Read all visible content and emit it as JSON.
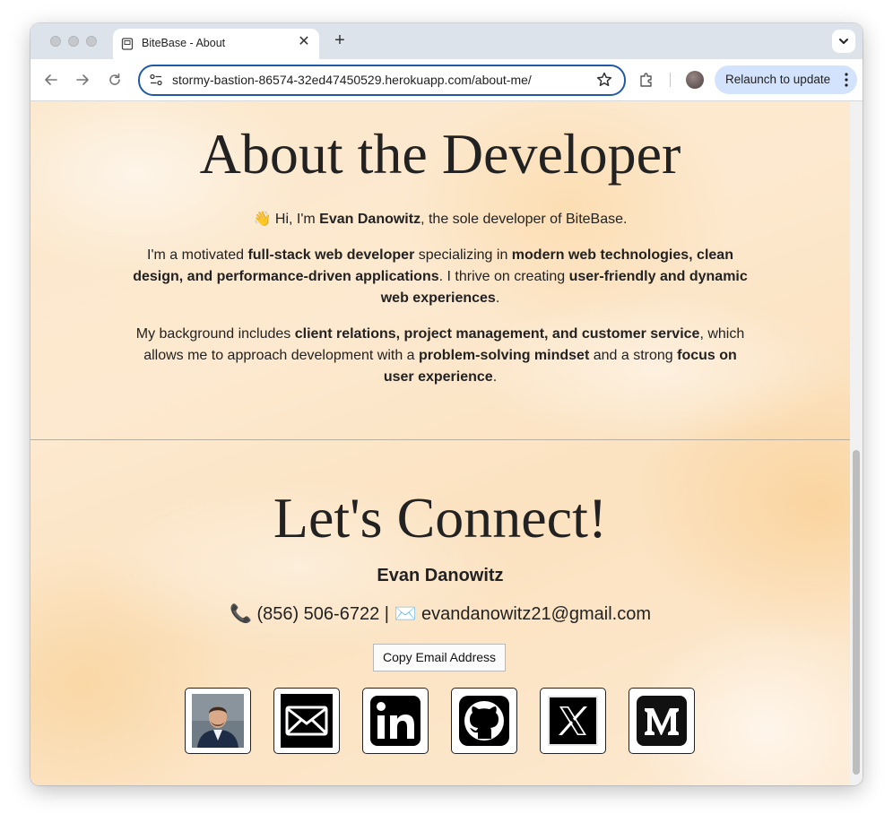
{
  "browser": {
    "tab_title": "BiteBase - About",
    "url": "stormy-bastion-86574-32ed47450529.herokuapp.com/about-me/",
    "relaunch_label": "Relaunch to update",
    "new_tab_symbol": "+",
    "close_symbol": "✕"
  },
  "about": {
    "title": "About the Developer",
    "intro": {
      "wave_icon": "👋",
      "pre": " Hi, I'm ",
      "name": "Evan Danowitz",
      "post": ", the sole developer of BiteBase."
    },
    "paragraph2": {
      "t1": "I'm a motivated ",
      "b1": "full-stack web developer",
      "t2": " specializing in ",
      "b2": "modern web technologies, clean design, and performance-driven applications",
      "t3": ". I thrive on creating ",
      "b3": "user-friendly and dynamic web experiences",
      "t4": "."
    },
    "paragraph3": {
      "t1": "My background includes ",
      "b1": "client relations, project management, and customer service",
      "t2": ", which allows me to approach development with a ",
      "b2": "problem-solving mindset",
      "t3": " and a strong ",
      "b3": "focus on user experience",
      "t4": "."
    }
  },
  "connect": {
    "title": "Let's Connect!",
    "name": "Evan Danowitz",
    "phone_icon": "📞",
    "phone": "(856) 506-6722",
    "separator": "|",
    "email_icon": "✉️",
    "email": "evandanowitz21@gmail.com",
    "copy_button": "Copy Email Address",
    "social_links": [
      "profile-photo",
      "email-icon",
      "linkedin-icon",
      "github-icon",
      "x-icon",
      "medium-icon"
    ]
  }
}
